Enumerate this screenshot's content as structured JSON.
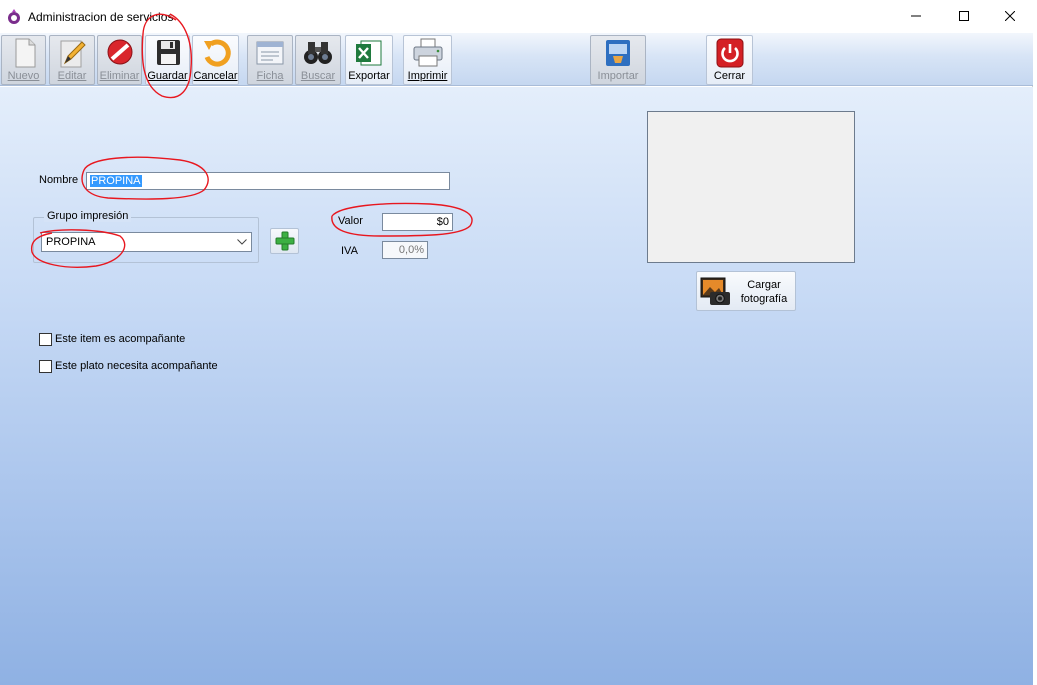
{
  "window": {
    "title": "Administracion de servicios"
  },
  "toolbar": {
    "buttons": [
      {
        "label": "Nuevo",
        "icon": "new-document-icon",
        "enabled": false
      },
      {
        "label": "Editar",
        "icon": "pencil-icon",
        "enabled": false
      },
      {
        "label": "Eliminar",
        "icon": "delete-icon",
        "enabled": false
      },
      {
        "label": "Guardar",
        "icon": "floppy-disk-icon",
        "enabled": true
      },
      {
        "label": "Cancelar",
        "icon": "undo-arrow-icon",
        "enabled": true
      },
      {
        "label": "Ficha",
        "icon": "form-sheet-icon",
        "enabled": false
      },
      {
        "label": "Buscar",
        "icon": "binoculars-icon",
        "enabled": false
      },
      {
        "label": "Exportar",
        "icon": "excel-icon",
        "enabled": true
      },
      {
        "label": "Imprimir",
        "icon": "printer-icon",
        "enabled": true
      },
      {
        "label": "Importar",
        "icon": "import-icon",
        "enabled": false
      },
      {
        "label": "Cerrar",
        "icon": "power-icon",
        "enabled": true
      }
    ]
  },
  "form": {
    "nombre_label": "Nombre",
    "nombre_value": "PROPINA",
    "grupo_legend": "Grupo impresión",
    "grupo_value": "PROPINA",
    "valor_label": "Valor",
    "valor_value": "$0",
    "iva_label": "IVA",
    "iva_value": "0,0%",
    "check_acompanante_label": "Este item es acompañante",
    "check_acompanante": false,
    "check_necesita_label": "Este plato necesita acompañante",
    "check_necesita": false,
    "cargar_label_1": "Cargar",
    "cargar_label_2": "fotografía"
  },
  "colors": {
    "annotation": "#e8171f",
    "selection": "#3399ff"
  }
}
